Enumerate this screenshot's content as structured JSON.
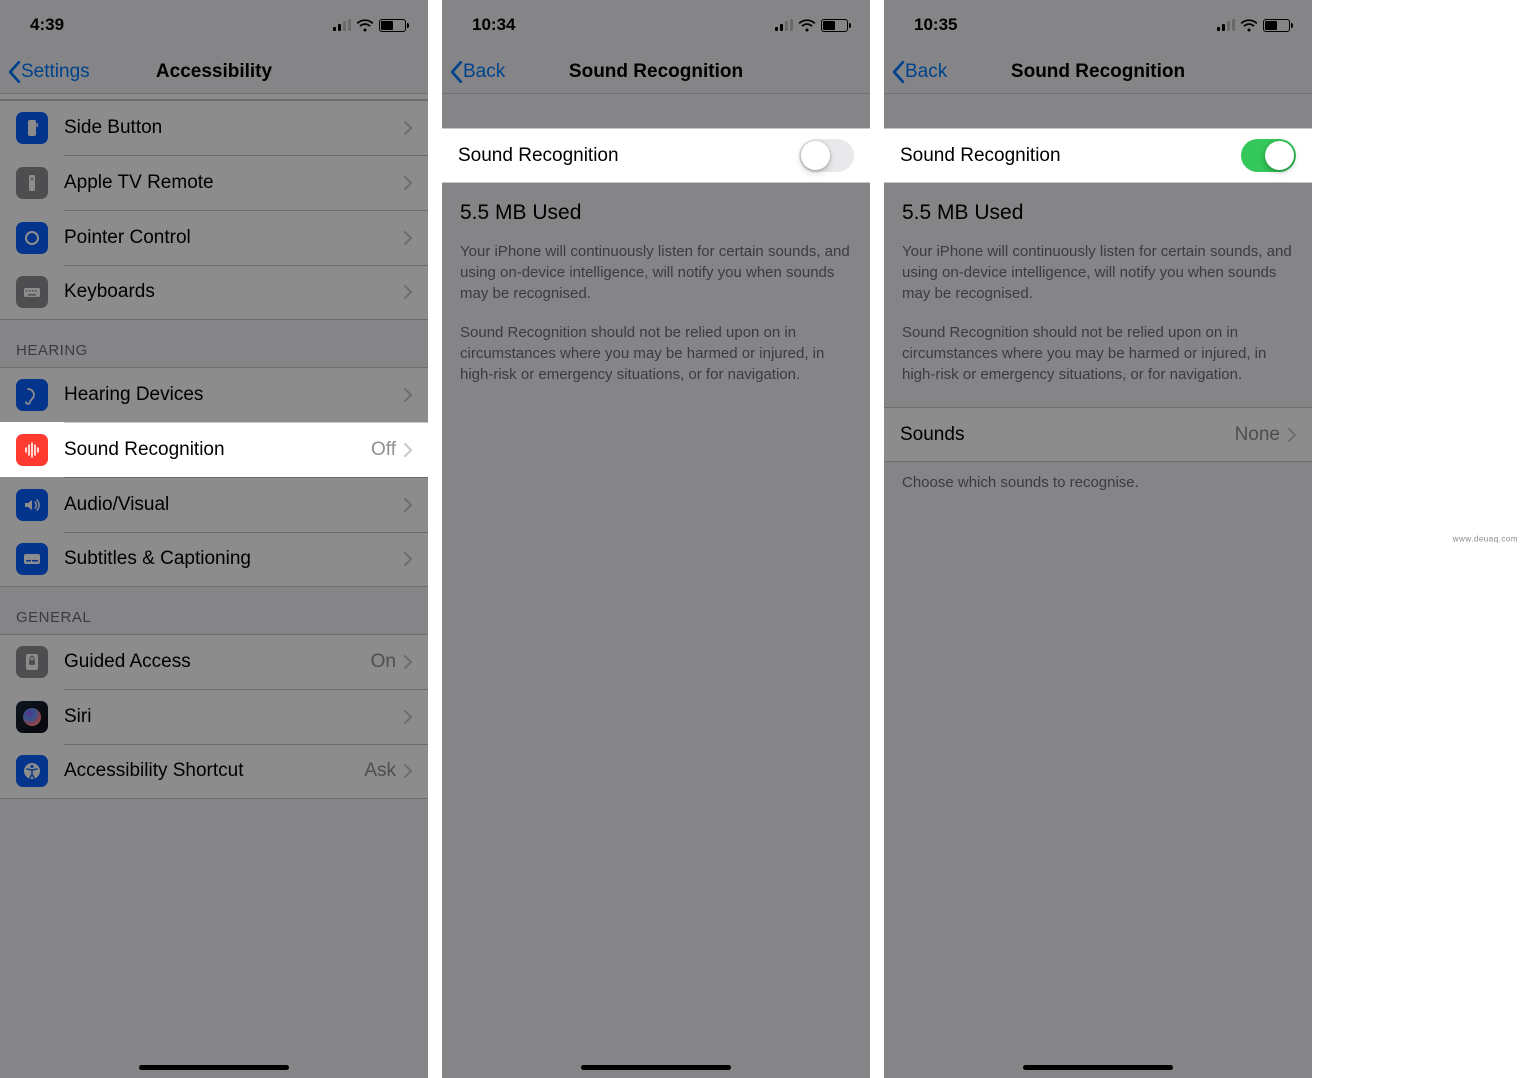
{
  "screen1": {
    "time": "4:39",
    "back_label": "Settings",
    "title": "Accessibility",
    "rows_top": [
      {
        "key": "side-button",
        "label": "Side Button"
      },
      {
        "key": "apple-tv-remote",
        "label": "Apple TV Remote"
      },
      {
        "key": "pointer-control",
        "label": "Pointer Control"
      },
      {
        "key": "keyboards",
        "label": "Keyboards"
      }
    ],
    "section_hearing": "HEARING",
    "rows_hearing": {
      "hearing_devices": "Hearing Devices",
      "sound_recognition": {
        "label": "Sound Recognition",
        "value": "Off"
      },
      "audio_visual": "Audio/Visual",
      "subtitles": "Subtitles & Captioning"
    },
    "section_general": "GENERAL",
    "rows_general": {
      "guided_access": {
        "label": "Guided Access",
        "value": "On"
      },
      "siri": "Siri",
      "accessibility_shortcut": {
        "label": "Accessibility Shortcut",
        "value": "Ask"
      }
    }
  },
  "screen2": {
    "time": "10:34",
    "back_label": "Back",
    "title": "Sound Recognition",
    "toggle_label": "Sound Recognition",
    "toggle_on": false,
    "storage": "5.5 MB Used",
    "desc1": "Your iPhone will continuously listen for certain sounds, and using on-device intelligence, will notify you when sounds may be recognised.",
    "desc2": "Sound Recognition should not be relied upon on in circumstances where you may be harmed or injured, in high-risk or emergency situations, or for navigation."
  },
  "screen3": {
    "time": "10:35",
    "back_label": "Back",
    "title": "Sound Recognition",
    "toggle_label": "Sound Recognition",
    "toggle_on": true,
    "storage": "5.5 MB Used",
    "desc1": "Your iPhone will continuously listen for certain sounds, and using on-device intelligence, will notify you when sounds may be recognised.",
    "desc2": "Sound Recognition should not be relied upon on in circumstances where you may be harmed or injured, in high-risk or emergency situations, or for navigation.",
    "sounds_row": {
      "label": "Sounds",
      "value": "None"
    },
    "sounds_footer": "Choose which sounds to recognise."
  },
  "watermark": "www.deuaq.com"
}
